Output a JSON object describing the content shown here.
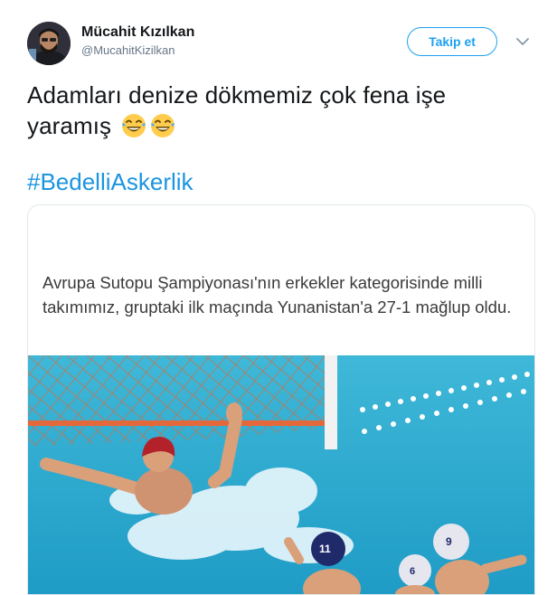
{
  "author": {
    "name": "Mücahit Kızılkan",
    "handle": "@MucahitKizilkan"
  },
  "actions": {
    "follow_label": "Takip et",
    "menu_icon": "chevron-down-icon"
  },
  "tweet": {
    "text": "Adamları denize dökmemiz çok fena işe yaramış",
    "emojis": [
      "face-with-tears-of-joy",
      "face-with-tears-of-joy"
    ],
    "hashtag": "#BedelliAskerlik"
  },
  "media": {
    "caption": "Avrupa Sutopu Şampiyonası'nın erkekler kategorisinde milli takımımız, gruptaki ilk maçında Yunanistan'a 27-1 mağlup oldu.",
    "cap_numbers": [
      "11",
      "9",
      "6"
    ]
  },
  "colors": {
    "accent": "#1da1f2",
    "hashtag": "#1b95e0",
    "text": "#14171a",
    "secondary": "#657786"
  }
}
